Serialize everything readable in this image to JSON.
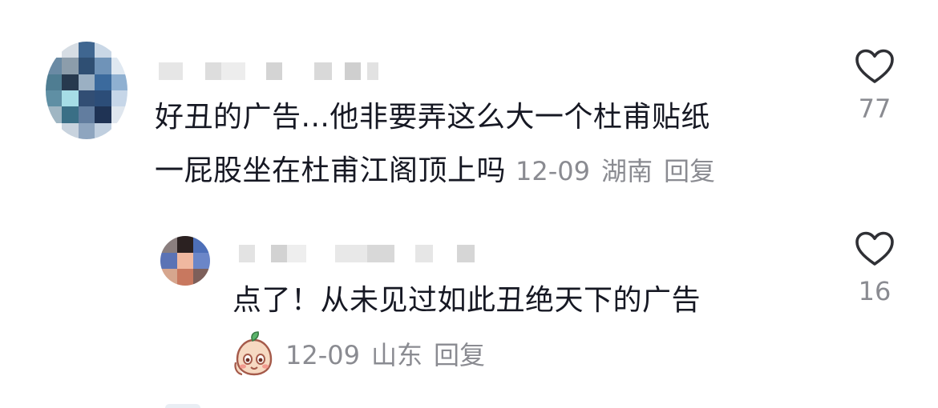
{
  "comments": [
    {
      "line1": "好丑的广告...他非要弄这么大一个杜甫贴纸",
      "line2": "一屁股坐在杜甫江阁顶上吗",
      "time": "12-09",
      "location": "湖南",
      "reply_label": "回复",
      "likes": "77",
      "heart_icon": "heart-outline-icon"
    },
    {
      "text": "点了！从未见过如此丑绝天下的广告",
      "time": "12-09",
      "location": "山东",
      "reply_label": "回复",
      "likes": "16",
      "heart_icon": "heart-outline-icon",
      "sticker_icon": "peach-face-emoji-icon"
    }
  ],
  "colors": {
    "text_primary": "#161823",
    "text_secondary": "#8a8b91",
    "icon_stroke": "#2f3035"
  }
}
